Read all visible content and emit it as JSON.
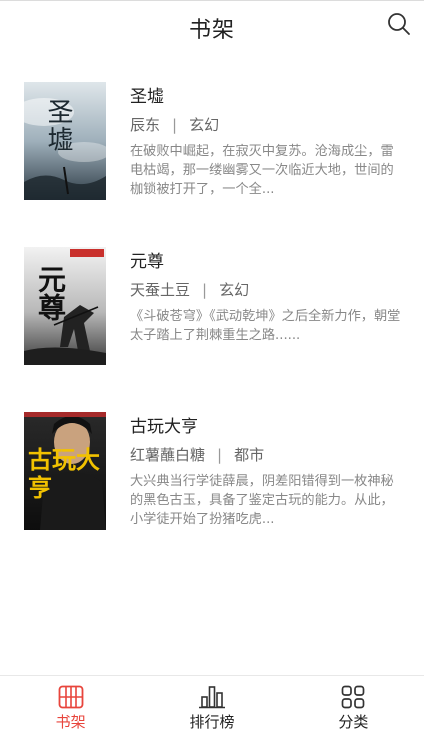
{
  "header": {
    "title": "书架",
    "search_icon": "search-icon"
  },
  "books": [
    {
      "title": "圣墟",
      "author": "辰东",
      "separator": "|",
      "category": "玄幻",
      "description": "在破败中崛起，在寂灭中复苏。沧海成尘，雷电枯竭，那一缕幽雾又一次临近大地，世间的枷锁被打开了，一个全...",
      "cover_text": "圣墟"
    },
    {
      "title": "元尊",
      "author": "天蚕土豆",
      "separator": "|",
      "category": "玄幻",
      "description": "《斗破苍穹》《武动乾坤》之后全新力作，朝堂太子踏上了荆棘重生之路......",
      "cover_text": "元尊"
    },
    {
      "title": "古玩大亨",
      "author": "红薯蘸白糖",
      "separator": "|",
      "category": "都市",
      "description": "大兴典当行学徒薛晨，阴差阳错得到一枚神秘的黑色古玉，具备了鉴定古玩的能力。从此，小学徒开始了扮猪吃虎...",
      "cover_text": "古玩大亨"
    }
  ],
  "tabbar": {
    "tabs": [
      {
        "label": "书架",
        "icon": "bookshelf-icon",
        "active": true
      },
      {
        "label": "排行榜",
        "icon": "bar-chart-icon",
        "active": false
      },
      {
        "label": "分类",
        "icon": "grid-icon",
        "active": false
      }
    ]
  },
  "colors": {
    "accent": "#e8453c",
    "text": "#222222",
    "meta": "#666666",
    "desc": "#888888"
  }
}
